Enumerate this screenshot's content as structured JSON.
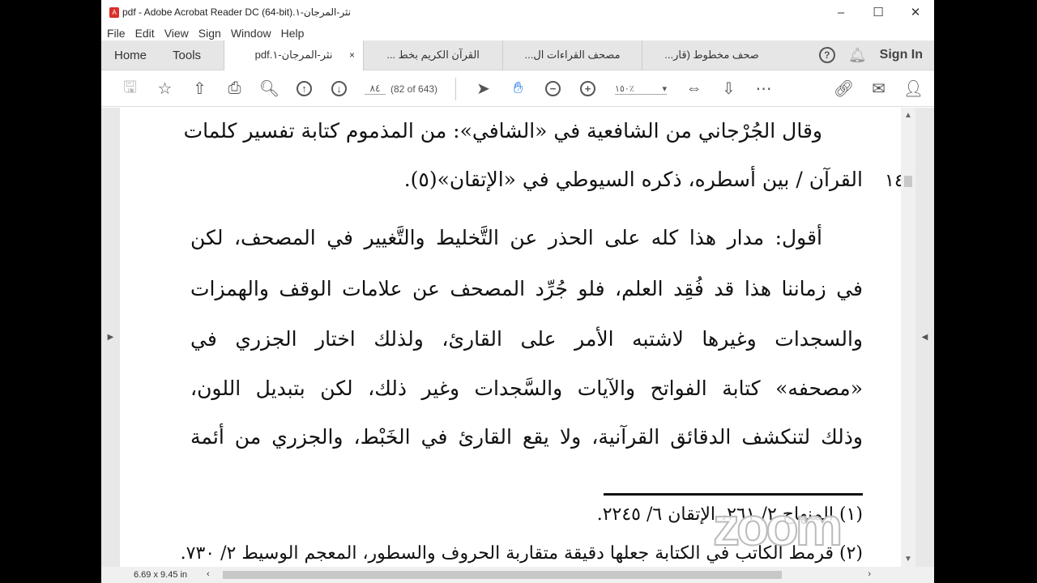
{
  "window": {
    "title": "نثر-المرجان-١.pdf - Adobe Acrobat Reader DC (64-bit)",
    "minimize": "–",
    "maximize": "☐",
    "close": "✕"
  },
  "menu": [
    "File",
    "Edit",
    "View",
    "Sign",
    "Window",
    "Help"
  ],
  "tabs": {
    "home": "Home",
    "tools": "Tools",
    "docs": [
      {
        "label": "نثر-المرجان-١.pdf",
        "close": "×"
      },
      {
        "label": "القرآن الكريم بخط ..."
      },
      {
        "label": "مصحف القراءات ال..."
      },
      {
        "label": "صحف مخطوط (قار..."
      }
    ],
    "help": "?",
    "sign_in": "Sign In"
  },
  "toolbar": {
    "page_number": "٨٤",
    "page_count": "(82 of 643)",
    "zoom": "١٥٠٪"
  },
  "document": {
    "lines": [
      "وقال الجُرْجاني من الشافعية في «الشافي»: من المذموم كتابة تفسير كلمات",
      "القرآن / بين أسطره، ذكره السيوطي في «الإتقان»(٥).",
      "أقول: مدار هذا كله على الحذر عن التَّخليط والتَّغيير في المصحف، لكن",
      "في زماننا هذا قد فُقِد العلم، فلو جُرِّد المصحف عن علامات الوقف والهمزات",
      "والسجدات وغيرها لاشتبه الأمر على القارئ، ولذلك اختار الجزري في",
      "«مصحفه» كتابة الفواتح والآيات والسَّجدات وغير ذلك، لكن بتبديل اللون،",
      "وذلك لتنكشف الدقائق القرآنية، ولا يقع القارئ في الخَبْط، والجزري من أئمة"
    ],
    "margin_number": "١٤",
    "footnotes": [
      "(١) المنهاج ٢/ ٢٦١، الإتقان ٦/ ٢٢٤٥.",
      "(٢) قرمط الكاتب في الكتابة جعلها دقيقة متقاربة الحروف والسطور، المعجم الوسيط ٢/ ٧٣٠."
    ]
  },
  "status": {
    "page_size": "6.69 x 9.45 in"
  },
  "watermark": "zoom"
}
